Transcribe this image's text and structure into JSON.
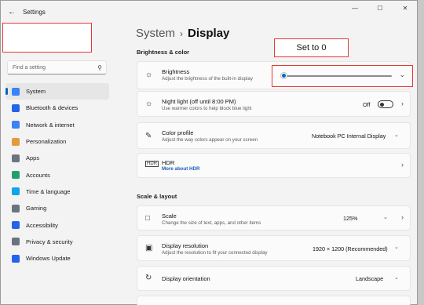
{
  "app": {
    "title": "Settings"
  },
  "window_controls": {
    "minimize": "—",
    "maximize": "☐",
    "close": "✕"
  },
  "search": {
    "placeholder": "Find a setting"
  },
  "nav": [
    {
      "label": "System",
      "icon": "monitor-icon",
      "color": "#3b82f6"
    },
    {
      "label": "Bluetooth & devices",
      "icon": "bluetooth-icon",
      "color": "#2563eb"
    },
    {
      "label": "Network & internet",
      "icon": "wifi-icon",
      "color": "#3b82f6"
    },
    {
      "label": "Personalization",
      "icon": "brush-icon",
      "color": "#e59a3c"
    },
    {
      "label": "Apps",
      "icon": "apps-icon",
      "color": "#6b7280"
    },
    {
      "label": "Accounts",
      "icon": "person-icon",
      "color": "#22a06b"
    },
    {
      "label": "Time & language",
      "icon": "globe-icon",
      "color": "#0ea5e9"
    },
    {
      "label": "Gaming",
      "icon": "gamepad-icon",
      "color": "#6b7280"
    },
    {
      "label": "Accessibility",
      "icon": "accessibility-icon",
      "color": "#2563eb"
    },
    {
      "label": "Privacy & security",
      "icon": "shield-icon",
      "color": "#6b7280"
    },
    {
      "label": "Windows Update",
      "icon": "update-icon",
      "color": "#2563eb"
    }
  ],
  "breadcrumb": {
    "parent": "System",
    "separator": "›",
    "current": "Display"
  },
  "sections": {
    "brightness_color": "Brightness & color",
    "scale_layout": "Scale & layout"
  },
  "brightness": {
    "label": "Brightness",
    "desc": "Adjust the brightness of the built-in display",
    "value": 0
  },
  "callout": "Set to 0",
  "night_light": {
    "label": "Night light (off until 8:00 PM)",
    "desc": "Use warmer colors to help block blue light",
    "state": "Off"
  },
  "color_profile": {
    "label": "Color profile",
    "desc": "Adjust the way colors appear on your screen",
    "value": "Notebook PC Internal Display"
  },
  "hdr": {
    "label": "HDR",
    "link": "More about HDR"
  },
  "scale": {
    "label": "Scale",
    "desc": "Change the size of text, apps, and other items",
    "value": "125%"
  },
  "resolution": {
    "label": "Display resolution",
    "desc": "Adjust the resolution to fit your connected display",
    "value": "1920 × 1200 (Recommended)"
  },
  "orientation": {
    "label": "Display orientation",
    "value": "Landscape"
  },
  "colors": {
    "accent": "#0067c0",
    "annotation": "#e53935"
  }
}
